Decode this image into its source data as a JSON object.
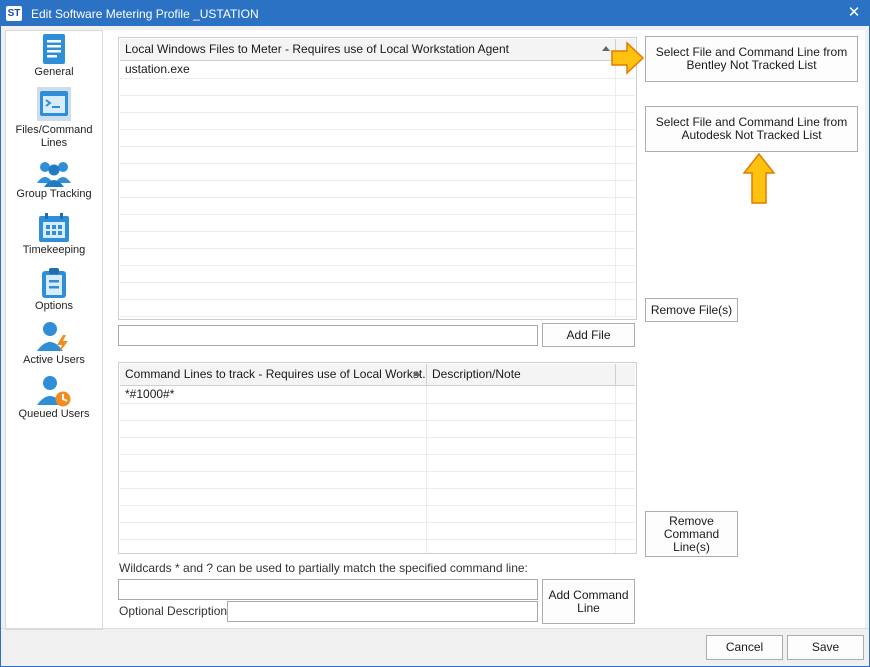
{
  "window": {
    "title": "Edit Software Metering Profile _USTATION",
    "app_icon_text": "ST",
    "close_glyph": "✕"
  },
  "sidebar": {
    "items": [
      {
        "label": "General",
        "icon": "document-icon"
      },
      {
        "label": "Files/Command Lines",
        "icon": "terminal-icon",
        "selected": true
      },
      {
        "label": "Group Tracking",
        "icon": "group-icon"
      },
      {
        "label": "Timekeeping",
        "icon": "calendar-icon"
      },
      {
        "label": "Options",
        "icon": "clipboard-icon"
      },
      {
        "label": "Active Users",
        "icon": "user-bolt-icon"
      },
      {
        "label": "Queued Users",
        "icon": "user-clock-icon"
      }
    ]
  },
  "files_grid": {
    "header": "Local Windows Files to Meter - Requires use of Local Workstation Agent",
    "rows": [
      "ustation.exe"
    ]
  },
  "file_input": {
    "value": ""
  },
  "buttons": {
    "add_file": "Add File",
    "bentley": "Select File and Command Line from Bentley Not Tracked List",
    "autodesk": "Select File and Command Line from Autodesk Not Tracked List",
    "remove_files": "Remove File(s)",
    "remove_cmd": "Remove Command Line(s)",
    "add_cmd": "Add Command Line",
    "cancel": "Cancel",
    "save": "Save"
  },
  "cmd_grid": {
    "headers": [
      "Command Lines to track - Requires use of Local Workst...",
      "Description/Note"
    ],
    "rows": [
      {
        "cmd": "*#1000#*",
        "note": ""
      }
    ]
  },
  "wildcard_hint": "Wildcards * and ? can be used to partially match the specified command line:",
  "cmd_input": {
    "value": ""
  },
  "optional_description": {
    "label": "Optional Description:",
    "value": ""
  },
  "colors": {
    "titlebar": "#2b72c4",
    "accent_icon": "#2e8fd8",
    "arrow_fill": "#ffc20e",
    "arrow_stroke": "#e07b00"
  }
}
